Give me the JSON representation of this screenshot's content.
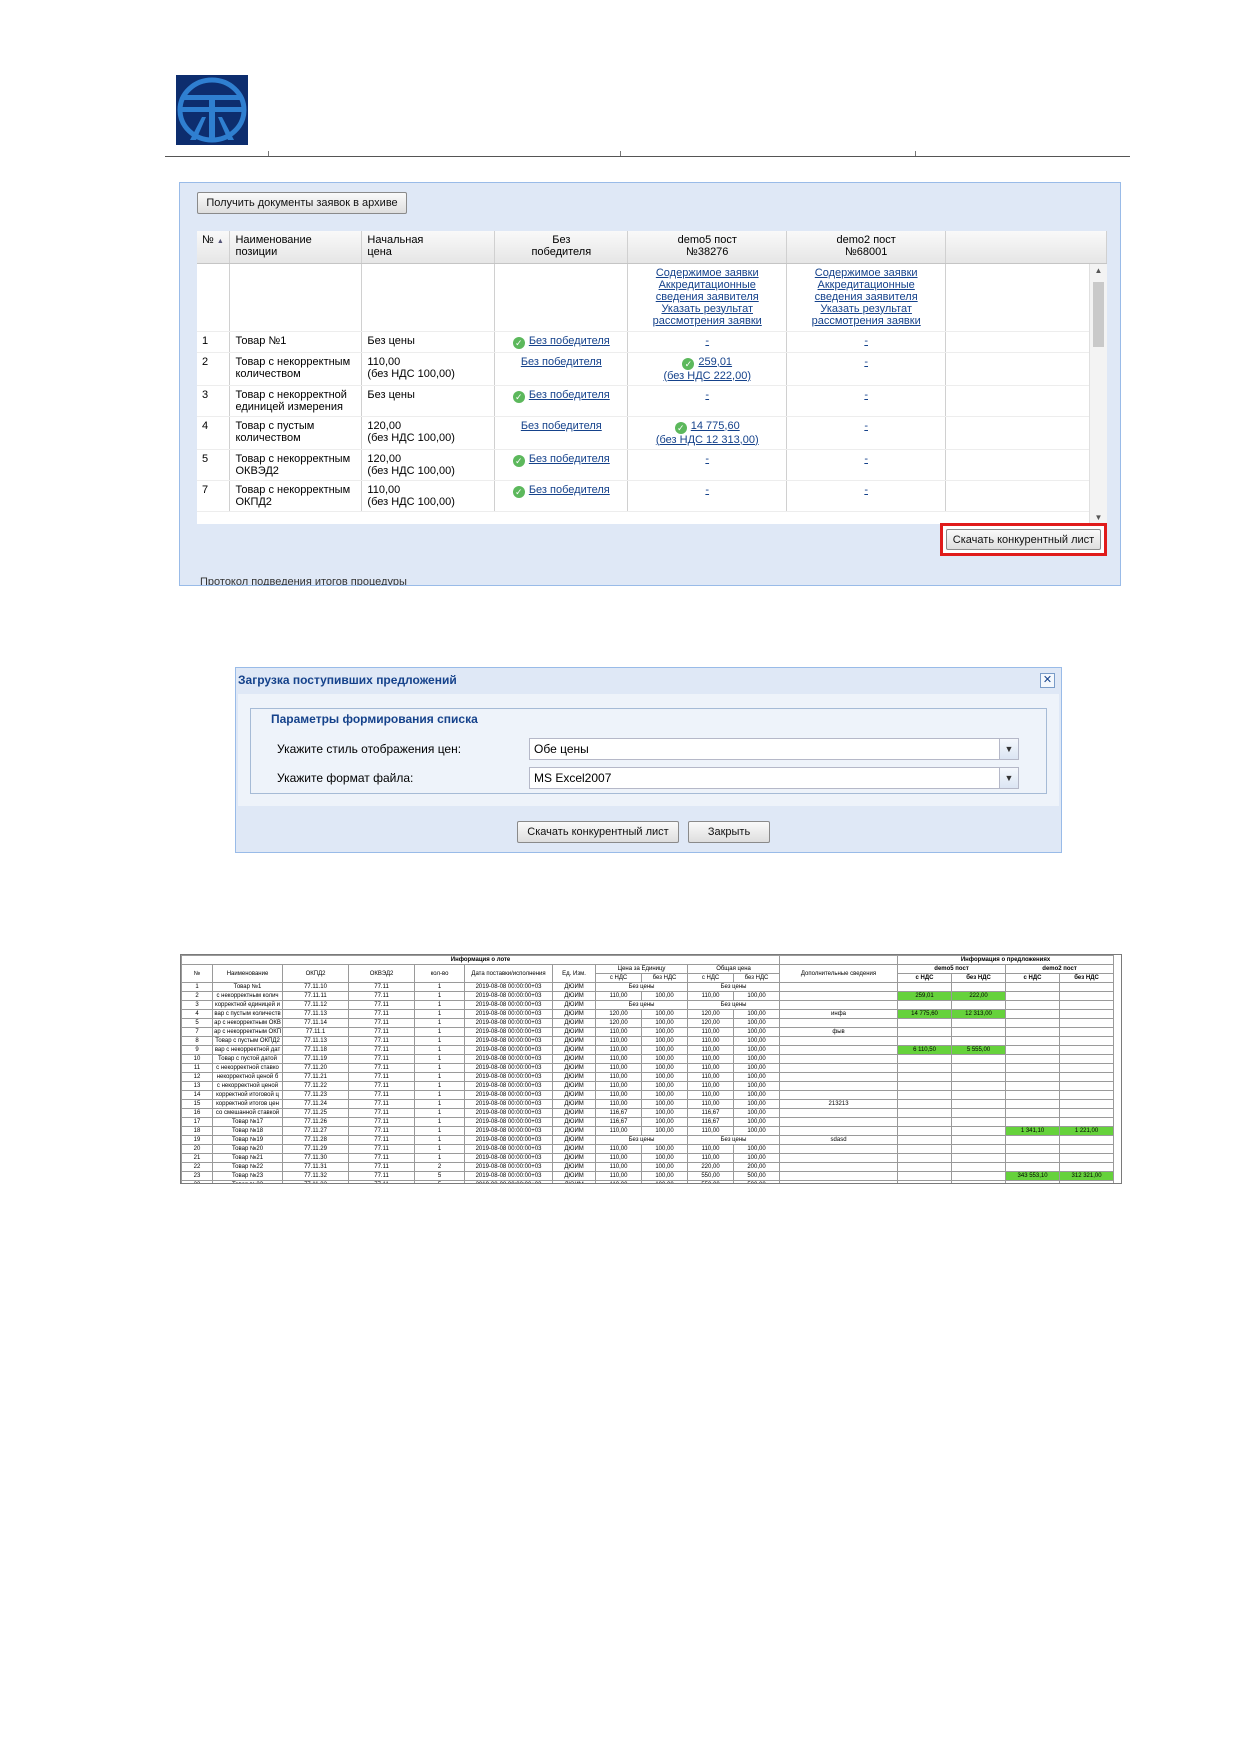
{
  "logo": {
    "icon": "company-logo-icon",
    "color": "#1a5ea8",
    "bg": "#0d2d6e"
  },
  "panel1": {
    "archive_button": "Получить документы заявок в архиве",
    "columns": [
      {
        "line1": "№",
        "line2": ""
      },
      {
        "line1": "Наименование",
        "line2": "позиции"
      },
      {
        "line1": "Начальная",
        "line2": "цена"
      },
      {
        "line1": "Без",
        "line2": "победителя"
      },
      {
        "line1": "demo5 пост",
        "line2": "№38276"
      },
      {
        "line1": "demo2 пост",
        "line2": "№68001"
      }
    ],
    "sort_icon": "sort-asc-icon",
    "supplier_links": [
      "Содержимое заявки",
      "Аккредитационные сведения заявителя",
      "Указать результат рассмотрения заявки"
    ],
    "rows": [
      {
        "num": "1",
        "name": "Товар №1",
        "price1": "Без цены",
        "price2": "",
        "nowin_check": true,
        "nowin": "Без победителя",
        "d5_check": false,
        "d5_v1": "-",
        "d5_v2": "",
        "d2": "-"
      },
      {
        "num": "2",
        "name": "Товар с некорректным количеством",
        "price1": "110,00",
        "price2": "(без НДС 100,00)",
        "nowin_check": false,
        "nowin": "Без победителя",
        "d5_check": true,
        "d5_v1": "259,01",
        "d5_v2": "(без НДС 222,00)",
        "d2": "-"
      },
      {
        "num": "3",
        "name": "Товар с некорректной единицей измерения",
        "price1": "Без цены",
        "price2": "",
        "nowin_check": true,
        "nowin": "Без победителя",
        "d5_check": false,
        "d5_v1": "-",
        "d5_v2": "",
        "d2": "-"
      },
      {
        "num": "4",
        "name": "Товар с пустым количеством",
        "price1": "120,00",
        "price2": "(без НДС 100,00)",
        "nowin_check": false,
        "nowin": "Без победителя",
        "d5_check": true,
        "d5_v1": "14 775,60",
        "d5_v2": "(без НДС 12 313,00)",
        "d2": "-"
      },
      {
        "num": "5",
        "name": "Товар с некорректным ОКВЭД2",
        "price1": "120,00",
        "price2": "(без НДС 100,00)",
        "nowin_check": true,
        "nowin": "Без победителя",
        "d5_check": false,
        "d5_v1": "-",
        "d5_v2": "",
        "d2": "-"
      },
      {
        "num": "7",
        "name": "Товар с некорректным ОКПД2",
        "price1": "110,00",
        "price2": "(без НДС 100,00)",
        "nowin_check": true,
        "nowin": "Без победителя",
        "d5_check": false,
        "d5_v1": "-",
        "d5_v2": "",
        "d2": "-"
      }
    ],
    "competitive_button": "Скачать конкурентный лист",
    "cut_text": "Протокол подведения итогов процедуры"
  },
  "dialog": {
    "title": "Загрузка поступивших предложений",
    "close_icon": "close-icon",
    "legend": "Параметры формирования списка",
    "price_style_label": "Укажите стиль отображения цен:",
    "price_style_value": "Обе цены",
    "format_label": "Укажите формат файла:",
    "format_value": "MS Excel2007",
    "download_button": "Скачать конкурентный лист",
    "close_button": "Закрыть"
  },
  "excel": {
    "lot_header": "Информация о лоте",
    "offers_header": "Информация о предложениях",
    "col_headers": [
      "№",
      "Наименование",
      "ОКПД2",
      "ОКВЭД2",
      "кол-во",
      "Дата поставки/исполнения",
      "Ед. Изм.",
      "Цена за Единицу",
      "Общая цена",
      "Дополнительные сведения"
    ],
    "sub_headers": [
      "с НДС",
      "без НДС",
      "с НДС",
      "без НДС"
    ],
    "suppliers": [
      "demo5 пост",
      "demo2 пост"
    ],
    "offer_sub": [
      "с НДС",
      "без НДС",
      "с НДС",
      "без НДС"
    ],
    "rows": [
      [
        "1",
        "Товар №1",
        "77.11.10",
        "77.11",
        "1",
        "2019-08-08 00:00:00+03",
        "ДЮЙМ",
        "",
        "",
        "",
        "",
        "",
        "",
        "",
        "",
        ""
      ],
      [
        "2",
        "с некорректным колич",
        "77.11.11",
        "77.11",
        "1",
        "2019-08-08 00:00:00+03",
        "ДЮЙМ",
        "110,00",
        "100,00",
        "110,00",
        "100,00",
        "",
        "259,01",
        "222,00",
        "",
        ""
      ],
      [
        "3",
        "корректной единицей и",
        "77.11.12",
        "77.11",
        "1",
        "2019-08-08 00:00:00+03",
        "ДЮЙМ",
        "",
        "",
        "",
        "",
        "",
        "",
        "",
        "",
        ""
      ],
      [
        "4",
        "вар с пустым количеств",
        "77.11.13",
        "77.11",
        "1",
        "2019-08-08 00:00:00+03",
        "ДЮЙМ",
        "120,00",
        "100,00",
        "120,00",
        "100,00",
        "инфа",
        "14 775,60",
        "12 313,00",
        "",
        ""
      ],
      [
        "5",
        "ар с некорректным ОКВ",
        "77.11.14",
        "77.11",
        "1",
        "2019-08-08 00:00:00+03",
        "ДЮЙМ",
        "120,00",
        "100,00",
        "120,00",
        "100,00",
        "",
        "",
        "",
        "",
        ""
      ],
      [
        "7",
        "ар с некорректным ОКП",
        "77.11.1",
        "77.11",
        "1",
        "2019-08-08 00:00:00+03",
        "ДЮЙМ",
        "110,00",
        "100,00",
        "110,00",
        "100,00",
        "фыв",
        "",
        "",
        "",
        ""
      ],
      [
        "8",
        "Товар с пустым ОКПД2",
        "77.11.13",
        "77.11",
        "1",
        "2019-08-08 00:00:00+03",
        "ДЮЙМ",
        "110,00",
        "100,00",
        "110,00",
        "100,00",
        "",
        "",
        "",
        "",
        ""
      ],
      [
        "9",
        "вар с некорректной дат",
        "77.11.18",
        "77.11",
        "1",
        "2019-08-08 00:00:00+03",
        "ДЮЙМ",
        "110,00",
        "100,00",
        "110,00",
        "100,00",
        "",
        "6 110,50",
        "5 555,00",
        "",
        ""
      ],
      [
        "10",
        "Товар с пустой датой",
        "77.11.19",
        "77.11",
        "1",
        "2019-08-08 00:00:00+03",
        "ДЮЙМ",
        "110,00",
        "100,00",
        "110,00",
        "100,00",
        "",
        "",
        "",
        "",
        ""
      ],
      [
        "11",
        "с некорректной ставко",
        "77.11.20",
        "77.11",
        "1",
        "2019-08-08 00:00:00+03",
        "ДЮЙМ",
        "110,00",
        "100,00",
        "110,00",
        "100,00",
        "",
        "",
        "",
        "",
        ""
      ],
      [
        "12",
        "некорректной ценой б",
        "77.11.21",
        "77.11",
        "1",
        "2019-08-08 00:00:00+03",
        "ДЮЙМ",
        "110,00",
        "100,00",
        "110,00",
        "100,00",
        "",
        "",
        "",
        "",
        ""
      ],
      [
        "13",
        "с некорректной ценой",
        "77.11.22",
        "77.11",
        "1",
        "2019-08-08 00:00:00+03",
        "ДЮЙМ",
        "110,00",
        "100,00",
        "110,00",
        "100,00",
        "",
        "",
        "",
        "",
        ""
      ],
      [
        "14",
        "корректной итоговой ц",
        "77.11.23",
        "77.11",
        "1",
        "2019-08-08 00:00:00+03",
        "ДЮЙМ",
        "110,00",
        "100,00",
        "110,00",
        "100,00",
        "",
        "",
        "",
        "",
        ""
      ],
      [
        "15",
        "корректной итогов цен",
        "77.11.24",
        "77.11",
        "1",
        "2019-08-08 00:00:00+03",
        "ДЮЙМ",
        "110,00",
        "100,00",
        "110,00",
        "100,00",
        "213213",
        "",
        "",
        "",
        ""
      ],
      [
        "16",
        "со смешанной ставкой",
        "77.11.25",
        "77.11",
        "1",
        "2019-08-08 00:00:00+03",
        "ДЮЙМ",
        "116,67",
        "100,00",
        "116,67",
        "100,00",
        "",
        "",
        "",
        "",
        ""
      ],
      [
        "17",
        "Товар №17",
        "77.11.26",
        "77.11",
        "1",
        "2019-08-08 00:00:00+03",
        "ДЮЙМ",
        "116,67",
        "100,00",
        "116,67",
        "100,00",
        "",
        "",
        "",
        "",
        ""
      ],
      [
        "18",
        "Товар №18",
        "77.11.27",
        "77.11",
        "1",
        "2019-08-08 00:00:00+03",
        "ДЮЙМ",
        "110,00",
        "100,00",
        "110,00",
        "100,00",
        "",
        "",
        "",
        "1 341,10",
        "1 221,00"
      ],
      [
        "19",
        "Товар №19",
        "77.11.28",
        "77.11",
        "1",
        "2019-08-08 00:00:00+03",
        "ДЮЙМ",
        "",
        "",
        "",
        "",
        "sdasd",
        "",
        "",
        "",
        ""
      ],
      [
        "20",
        "Товар №20",
        "77.11.29",
        "77.11",
        "1",
        "2019-08-08 00:00:00+03",
        "ДЮЙМ",
        "110,00",
        "100,00",
        "110,00",
        "100,00",
        "",
        "",
        "",
        "",
        ""
      ],
      [
        "21",
        "Товар №21",
        "77.11.30",
        "77.11",
        "1",
        "2019-08-08 00:00:00+03",
        "ДЮЙМ",
        "110,00",
        "100,00",
        "110,00",
        "100,00",
        "",
        "",
        "",
        "",
        ""
      ],
      [
        "22",
        "Товар №22",
        "77.11.31",
        "77.11",
        "2",
        "2019-08-08 00:00:00+03",
        "ДЮЙМ",
        "110,00",
        "100,00",
        "220,00",
        "200,00",
        "",
        "",
        "",
        "",
        ""
      ],
      [
        "23",
        "Товар №23",
        "77.11.32",
        "77.11",
        "5",
        "2019-08-08 00:00:00+03",
        "ДЮЙМ",
        "110,00",
        "100,00",
        "550,00",
        "500,00",
        "",
        "",
        "",
        "343 553,10",
        "312 321,00"
      ],
      [
        "23",
        "Товар №23",
        "77.11.32",
        "77.11",
        "5",
        "2019-08-08 00:00:00+03",
        "ДЮЙМ",
        "110,00",
        "100,00",
        "550,00",
        "500,00",
        "",
        "",
        "",
        "",
        ""
      ]
    ],
    "no_price": "Без цены",
    "no_price_rows": [
      0,
      2,
      17
    ],
    "highlight_color": "#66d23c"
  }
}
